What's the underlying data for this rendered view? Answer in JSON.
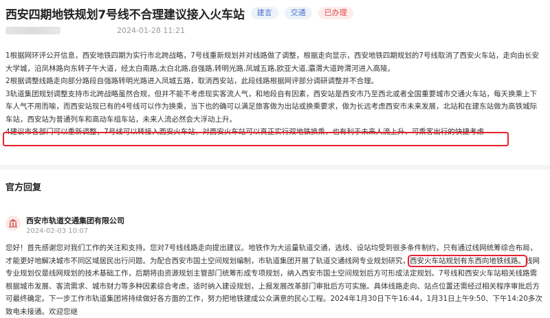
{
  "post": {
    "title": "西安四期地铁规划7号线不合理建议接入火车站",
    "tags": [
      "建言",
      "交通",
      "已办理"
    ],
    "timestamp": "2024-01-28 11:21"
  },
  "content": {
    "paragraphs": [
      "1根据网环评公开信息，西安地铁四期为实行市北跨战略，7号线重新规划并对线路做了调整，根据走向显示，西安地铁四期规划的7号线取消了西安火车站，走向由长安大学城，沿凤林路向东转子午大道，经太白南路,太白北路,自强路,转明光路,凤城五路,欧亚大道,灞渭大道跨渭河进入高陵。",
      "2根据调整线路走向部分路段自强路转明光路进入凤城五路，取消西安站，此段线路根据网评部分调研调整并不合理。",
      "3轨道集团规划调整支持市北跨战略虽然合规，但并不能不考虑现实客流人气，和地段自有因素，西安站是西安市乃至西北或者全国重要城市交通火车站，每天换乘上下车人气不用而喻，而西安站现已有的4号线可以作为换乘，当下也的确可以满足旅客做为出站或换乘要求，做为长远考虑西安市未来发展，北站和在建东站做为高铁城际车站，西安站为普通列车和高动车组车站，未来人流必然会大浮动上升。",
      "4建议市各部门可以重新调整，7号线可以转接入西安火车站，对西安火车站可以真正实行双地铁换乘，也有利于未来人流上升，可乘客出行的快捷考虑"
    ]
  },
  "reply": {
    "section_title": "官方回复",
    "org_name": "西安市轨道交通集团有限公司",
    "date": "2024-02-03 10:07",
    "text_before": "您好！首先感谢您对我们工作的关注和支持。您对7号线线路走向提出建议。地铁作为大运量轨道交通，选线、设站均受到很多条件制约，只有通过线网统筹综合布局，才能更好地解决城市不同区域居民出行问题。为配合西安市国土空间规划编制，市轨道集团开展了轨道交通线网专业规划研究，",
    "text_highlight": "西安火车站规划有东西向地铁线路。",
    "text_after": "线网专业规划仅是线网规划的技术基础工作，后期将由资源规划主管部门统筹形成专项规划，纳入西安市国土空间规划后方可形成法定规划。7号线和西安火车站相关线路需根据城市发展、客流需求、城市财力等多种因素综合考虑，适时纳入建设规划，上报发展改革部门审批后方可实施。具体线路走向、站点位置还需经过相关程序审批后方可最终确定。下一步工作市轨道集团将持续做好各方面的工作，努力把地铁建成公众满意的民心工程。2024年1月30日下午16:44，1月31日上午9:50、下午14:20多次致电未接通。欢迎您继"
  },
  "colors": {
    "tag_blue_text": "#4a73c9",
    "tag_blue_bg": "#edf2fb",
    "tag_red_text": "#e04a4a",
    "tag_red_bg": "#fdecec",
    "highlight_red": "#e8202a"
  },
  "icons": {
    "org_logo": "government-building-icon"
  }
}
